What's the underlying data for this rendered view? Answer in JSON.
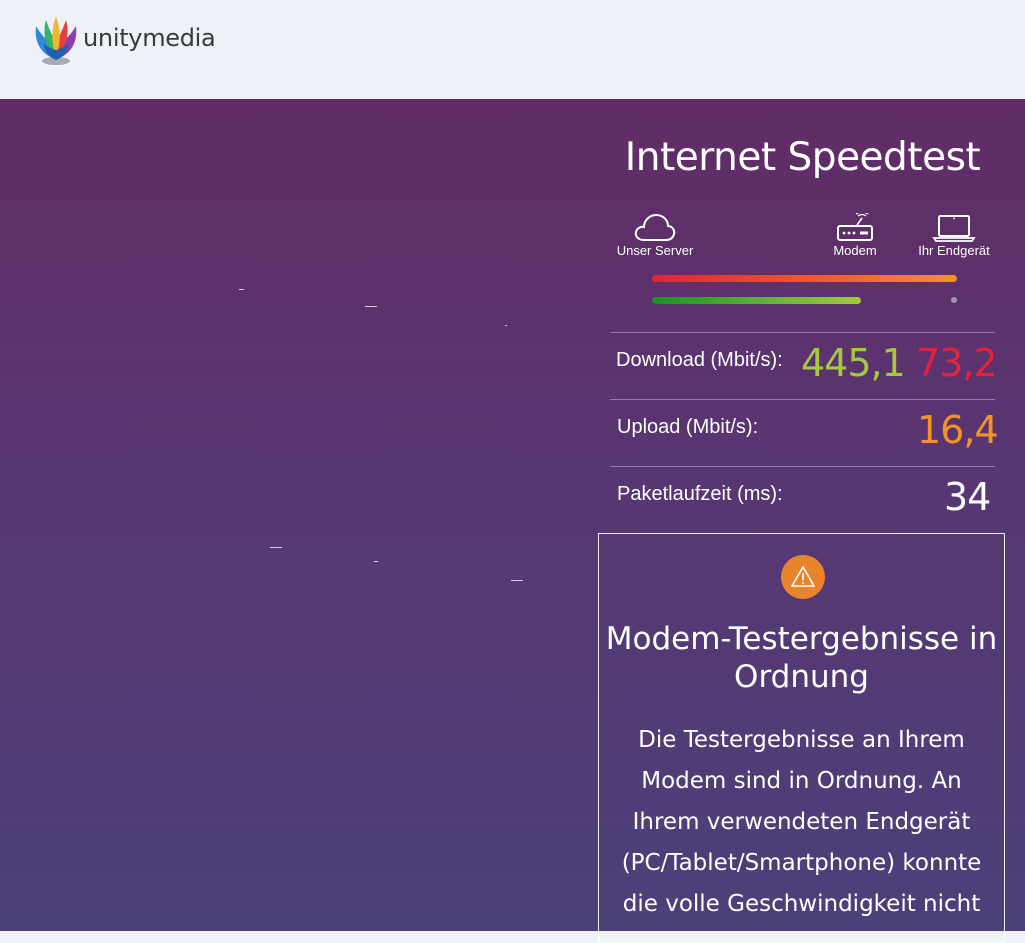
{
  "header": {
    "logo_text": "unitymedia"
  },
  "speedtest": {
    "title": "Internet Speedtest",
    "devices": {
      "server": {
        "label": "Unser Server",
        "icon": "cloud-icon"
      },
      "modem": {
        "label": "Modem",
        "icon": "modem-icon"
      },
      "endgeraet": {
        "label": "Ihr Endgerät",
        "icon": "laptop-icon"
      }
    },
    "results": {
      "download": {
        "label": "Download (Mbit/s):",
        "modem_value": "445,1",
        "device_value": "73,2"
      },
      "upload": {
        "label": "Upload (Mbit/s):",
        "value": "16,4"
      },
      "latency": {
        "label": "Paketlaufzeit (ms):",
        "value": "34"
      }
    }
  },
  "result_box": {
    "icon": "warning-icon",
    "title": "Modem-Testergebnisse in Ordnung",
    "text": "Die Testergebnisse an Ihrem Modem sind in Ordnung. An Ihrem verwendeten Endgerät (PC/Tablet/Smartphone) konnte die volle Geschwindigkeit nicht"
  },
  "colors": {
    "background_top": "#612c65",
    "background_bottom": "#4c4079",
    "green_value": "#a4c93f",
    "red_value": "#e5213c",
    "orange_value": "#f39326",
    "warning": "#e8842d"
  }
}
